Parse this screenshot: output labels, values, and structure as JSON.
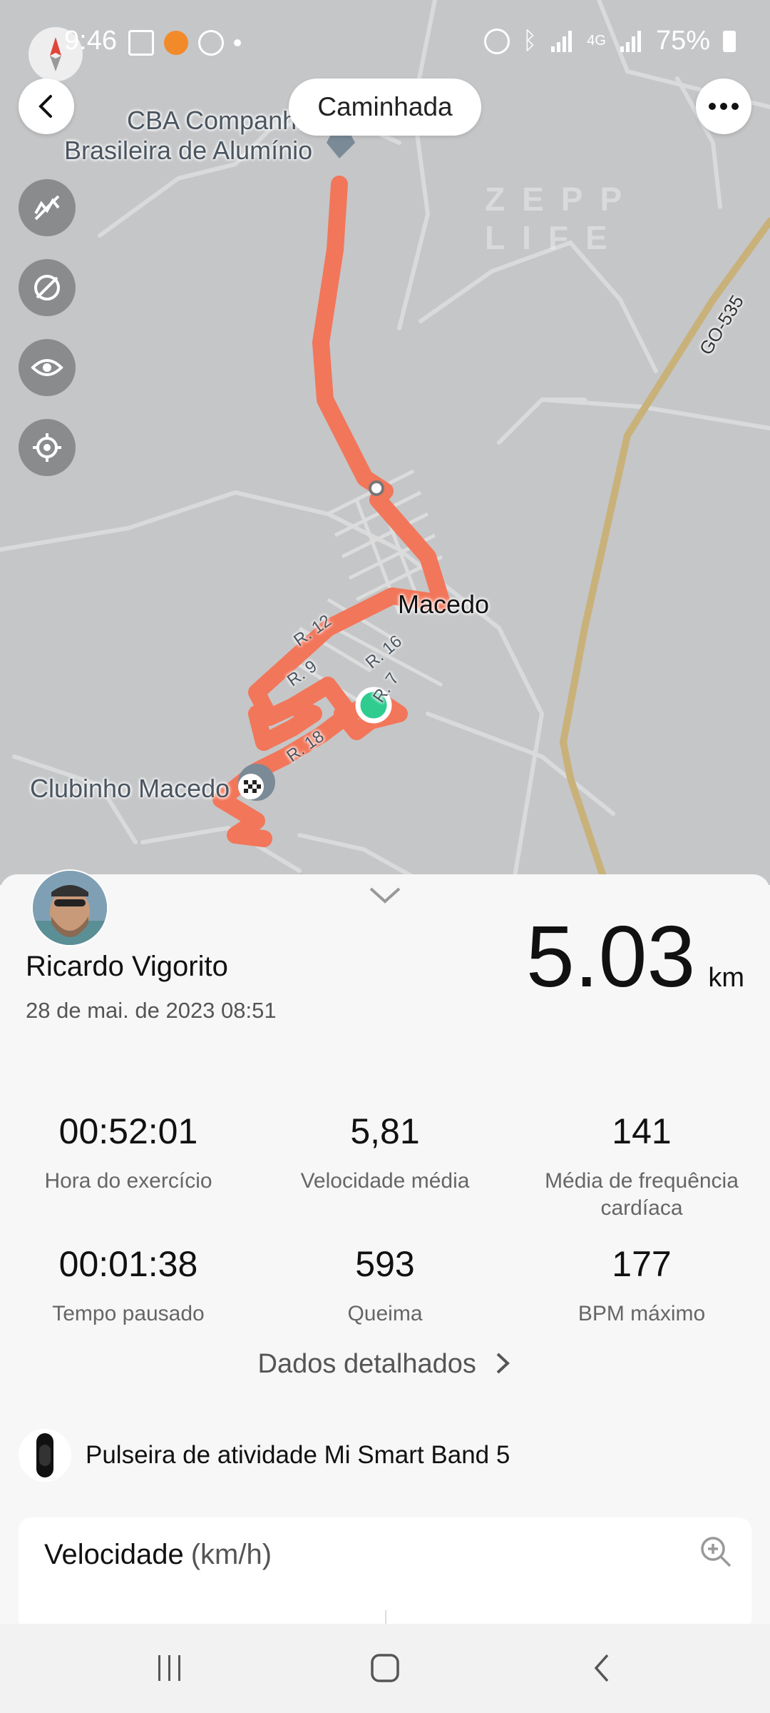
{
  "status_bar": {
    "time": "9:46",
    "battery": "75%",
    "network": "4G"
  },
  "map": {
    "activity_type": "Caminhada",
    "labels": {
      "cba_line1": "CBA Companhi",
      "cba_line2": "Brasileira de Alumínio",
      "macedo": "Macedo",
      "clubinho": "Clubinho Macedo",
      "road_go535": "GO-535",
      "r12": "R. 12",
      "r9": "R. 9",
      "r16": "R. 16",
      "r7": "R. 7",
      "r18": "R. 18"
    },
    "watermark": "ZEPP LIFE",
    "colors": {
      "route": "#f2765a",
      "start": "#2ecc8f",
      "background": "#c5c6c8"
    }
  },
  "summary": {
    "user_name": "Ricardo Vigorito",
    "date": "28 de mai. de 2023 08:51",
    "distance_value": "5.03",
    "distance_unit": "km"
  },
  "stats": [
    {
      "value": "00:52:01",
      "label": "Hora do exercício"
    },
    {
      "value": "5,81",
      "label": "Velocidade média"
    },
    {
      "value": "141",
      "label": "Média de frequência cardíaca"
    },
    {
      "value": "00:01:38",
      "label": "Tempo pausado"
    },
    {
      "value": "593",
      "label": "Queima"
    },
    {
      "value": "177",
      "label": "BPM máximo"
    }
  ],
  "detail_link": "Dados detalhados",
  "device": "Pulseira de atividade Mi Smart Band 5",
  "speed_card": {
    "title": "Velocidade",
    "unit": "(km/h)"
  }
}
